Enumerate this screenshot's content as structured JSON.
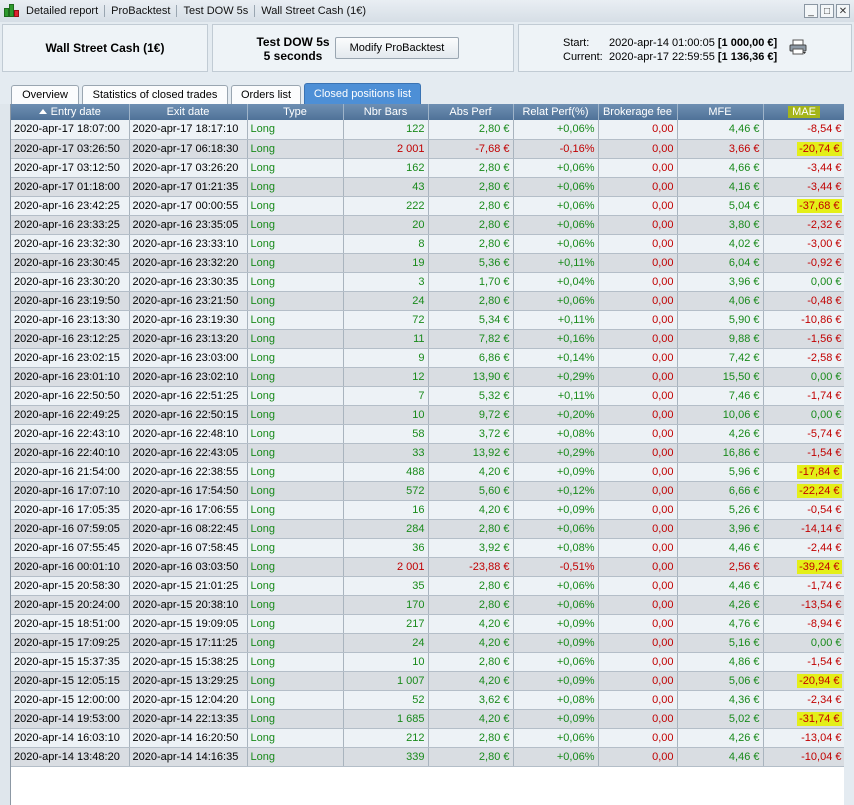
{
  "titlebar": {
    "crumbs": [
      "Detailed report",
      "ProBacktest",
      "Test DOW 5s",
      "Wall Street Cash (1€)"
    ],
    "buttons": [
      "_",
      "□",
      "✕"
    ]
  },
  "header": {
    "instrument": "Wall Street Cash (1€)",
    "strategy_name": "Test DOW 5s",
    "strategy_interval": "5 seconds",
    "modify_button": "Modify ProBacktest",
    "start_label": "Start:",
    "start_date": "2020-apr-14 01:00:05",
    "start_capital": "[1 000,00 €]",
    "current_label": "Current:",
    "current_date": "2020-apr-17 22:59:55",
    "current_capital": "[1 136,36 €]"
  },
  "tabs": [
    "Overview",
    "Statistics of closed trades",
    "Orders list",
    "Closed positions list"
  ],
  "active_tab": 3,
  "columns": [
    "Entry date",
    "Exit date",
    "Type",
    "Nbr Bars",
    "Abs Perf",
    "Relat Perf(%)",
    "Brokerage fee",
    "MFE",
    "MAE"
  ],
  "rows": [
    [
      "2020-apr-17 18:07:00",
      "2020-apr-17 18:17:10",
      "Long",
      "122",
      "2,80 €",
      "+0,06%",
      "0,00",
      "4,46 €",
      "-8,54 €"
    ],
    [
      "2020-apr-17 03:26:50",
      "2020-apr-17 06:18:30",
      "Long",
      "2 001",
      "-7,68 €",
      "-0,16%",
      "0,00",
      "3,66 €",
      "-20,74 €"
    ],
    [
      "2020-apr-17 03:12:50",
      "2020-apr-17 03:26:20",
      "Long",
      "162",
      "2,80 €",
      "+0,06%",
      "0,00",
      "4,66 €",
      "-3,44 €"
    ],
    [
      "2020-apr-17 01:18:00",
      "2020-apr-17 01:21:35",
      "Long",
      "43",
      "2,80 €",
      "+0,06%",
      "0,00",
      "4,16 €",
      "-3,44 €"
    ],
    [
      "2020-apr-16 23:42:25",
      "2020-apr-17 00:00:55",
      "Long",
      "222",
      "2,80 €",
      "+0,06%",
      "0,00",
      "5,04 €",
      "-37,68 €"
    ],
    [
      "2020-apr-16 23:33:25",
      "2020-apr-16 23:35:05",
      "Long",
      "20",
      "2,80 €",
      "+0,06%",
      "0,00",
      "3,80 €",
      "-2,32 €"
    ],
    [
      "2020-apr-16 23:32:30",
      "2020-apr-16 23:33:10",
      "Long",
      "8",
      "2,80 €",
      "+0,06%",
      "0,00",
      "4,02 €",
      "-3,00 €"
    ],
    [
      "2020-apr-16 23:30:45",
      "2020-apr-16 23:32:20",
      "Long",
      "19",
      "5,36 €",
      "+0,11%",
      "0,00",
      "6,04 €",
      "-0,92 €"
    ],
    [
      "2020-apr-16 23:30:20",
      "2020-apr-16 23:30:35",
      "Long",
      "3",
      "1,70 €",
      "+0,04%",
      "0,00",
      "3,96 €",
      "0,00 €"
    ],
    [
      "2020-apr-16 23:19:50",
      "2020-apr-16 23:21:50",
      "Long",
      "24",
      "2,80 €",
      "+0,06%",
      "0,00",
      "4,06 €",
      "-0,48 €"
    ],
    [
      "2020-apr-16 23:13:30",
      "2020-apr-16 23:19:30",
      "Long",
      "72",
      "5,34 €",
      "+0,11%",
      "0,00",
      "5,90 €",
      "-10,86 €"
    ],
    [
      "2020-apr-16 23:12:25",
      "2020-apr-16 23:13:20",
      "Long",
      "11",
      "7,82 €",
      "+0,16%",
      "0,00",
      "9,88 €",
      "-1,56 €"
    ],
    [
      "2020-apr-16 23:02:15",
      "2020-apr-16 23:03:00",
      "Long",
      "9",
      "6,86 €",
      "+0,14%",
      "0,00",
      "7,42 €",
      "-2,58 €"
    ],
    [
      "2020-apr-16 23:01:10",
      "2020-apr-16 23:02:10",
      "Long",
      "12",
      "13,90 €",
      "+0,29%",
      "0,00",
      "15,50 €",
      "0,00 €"
    ],
    [
      "2020-apr-16 22:50:50",
      "2020-apr-16 22:51:25",
      "Long",
      "7",
      "5,32 €",
      "+0,11%",
      "0,00",
      "7,46 €",
      "-1,74 €"
    ],
    [
      "2020-apr-16 22:49:25",
      "2020-apr-16 22:50:15",
      "Long",
      "10",
      "9,72 €",
      "+0,20%",
      "0,00",
      "10,06 €",
      "0,00 €"
    ],
    [
      "2020-apr-16 22:43:10",
      "2020-apr-16 22:48:10",
      "Long",
      "58",
      "3,72 €",
      "+0,08%",
      "0,00",
      "4,26 €",
      "-5,74 €"
    ],
    [
      "2020-apr-16 22:40:10",
      "2020-apr-16 22:43:05",
      "Long",
      "33",
      "13,92 €",
      "+0,29%",
      "0,00",
      "16,86 €",
      "-1,54 €"
    ],
    [
      "2020-apr-16 21:54:00",
      "2020-apr-16 22:38:55",
      "Long",
      "488",
      "4,20 €",
      "+0,09%",
      "0,00",
      "5,96 €",
      "-17,84 €"
    ],
    [
      "2020-apr-16 17:07:10",
      "2020-apr-16 17:54:50",
      "Long",
      "572",
      "5,60 €",
      "+0,12%",
      "0,00",
      "6,66 €",
      "-22,24 €"
    ],
    [
      "2020-apr-16 17:05:35",
      "2020-apr-16 17:06:55",
      "Long",
      "16",
      "4,20 €",
      "+0,09%",
      "0,00",
      "5,26 €",
      "-0,54 €"
    ],
    [
      "2020-apr-16 07:59:05",
      "2020-apr-16 08:22:45",
      "Long",
      "284",
      "2,80 €",
      "+0,06%",
      "0,00",
      "3,96 €",
      "-14,14 €"
    ],
    [
      "2020-apr-16 07:55:45",
      "2020-apr-16 07:58:45",
      "Long",
      "36",
      "3,92 €",
      "+0,08%",
      "0,00",
      "4,46 €",
      "-2,44 €"
    ],
    [
      "2020-apr-16 00:01:10",
      "2020-apr-16 03:03:50",
      "Long",
      "2 001",
      "-23,88 €",
      "-0,51%",
      "0,00",
      "2,56 €",
      "-39,24 €"
    ],
    [
      "2020-apr-15 20:58:30",
      "2020-apr-15 21:01:25",
      "Long",
      "35",
      "2,80 €",
      "+0,06%",
      "0,00",
      "4,46 €",
      "-1,74 €"
    ],
    [
      "2020-apr-15 20:24:00",
      "2020-apr-15 20:38:10",
      "Long",
      "170",
      "2,80 €",
      "+0,06%",
      "0,00",
      "4,26 €",
      "-13,54 €"
    ],
    [
      "2020-apr-15 18:51:00",
      "2020-apr-15 19:09:05",
      "Long",
      "217",
      "4,20 €",
      "+0,09%",
      "0,00",
      "4,76 €",
      "-8,94 €"
    ],
    [
      "2020-apr-15 17:09:25",
      "2020-apr-15 17:11:25",
      "Long",
      "24",
      "4,20 €",
      "+0,09%",
      "0,00",
      "5,16 €",
      "0,00 €"
    ],
    [
      "2020-apr-15 15:37:35",
      "2020-apr-15 15:38:25",
      "Long",
      "10",
      "2,80 €",
      "+0,06%",
      "0,00",
      "4,86 €",
      "-1,54 €"
    ],
    [
      "2020-apr-15 12:05:15",
      "2020-apr-15 13:29:25",
      "Long",
      "1 007",
      "4,20 €",
      "+0,09%",
      "0,00",
      "5,06 €",
      "-20,94 €"
    ],
    [
      "2020-apr-15 12:00:00",
      "2020-apr-15 12:04:20",
      "Long",
      "52",
      "3,62 €",
      "+0,08%",
      "0,00",
      "4,36 €",
      "-2,34 €"
    ],
    [
      "2020-apr-14 19:53:00",
      "2020-apr-14 22:13:35",
      "Long",
      "1 685",
      "4,20 €",
      "+0,09%",
      "0,00",
      "5,02 €",
      "-31,74 €"
    ],
    [
      "2020-apr-14 16:03:10",
      "2020-apr-14 16:20:50",
      "Long",
      "212",
      "2,80 €",
      "+0,06%",
      "0,00",
      "4,26 €",
      "-13,04 €"
    ],
    [
      "2020-apr-14 13:48:20",
      "2020-apr-14 14:16:35",
      "Long",
      "339",
      "2,80 €",
      "+0,06%",
      "0,00",
      "4,46 €",
      "-10,04 €"
    ]
  ],
  "highlighted_mae_rows": [
    1,
    4,
    18,
    19,
    23,
    29,
    31
  ],
  "colors": {
    "positive": "#198a1b",
    "negative": "#c10000",
    "highlight": "#e4ef18",
    "active_tab": "#4d8fd6",
    "header": "#4f7298"
  },
  "icons": {
    "app": "candlestick-chart-icon",
    "print": "printer-icon",
    "sort": "sort-ascending-icon"
  }
}
